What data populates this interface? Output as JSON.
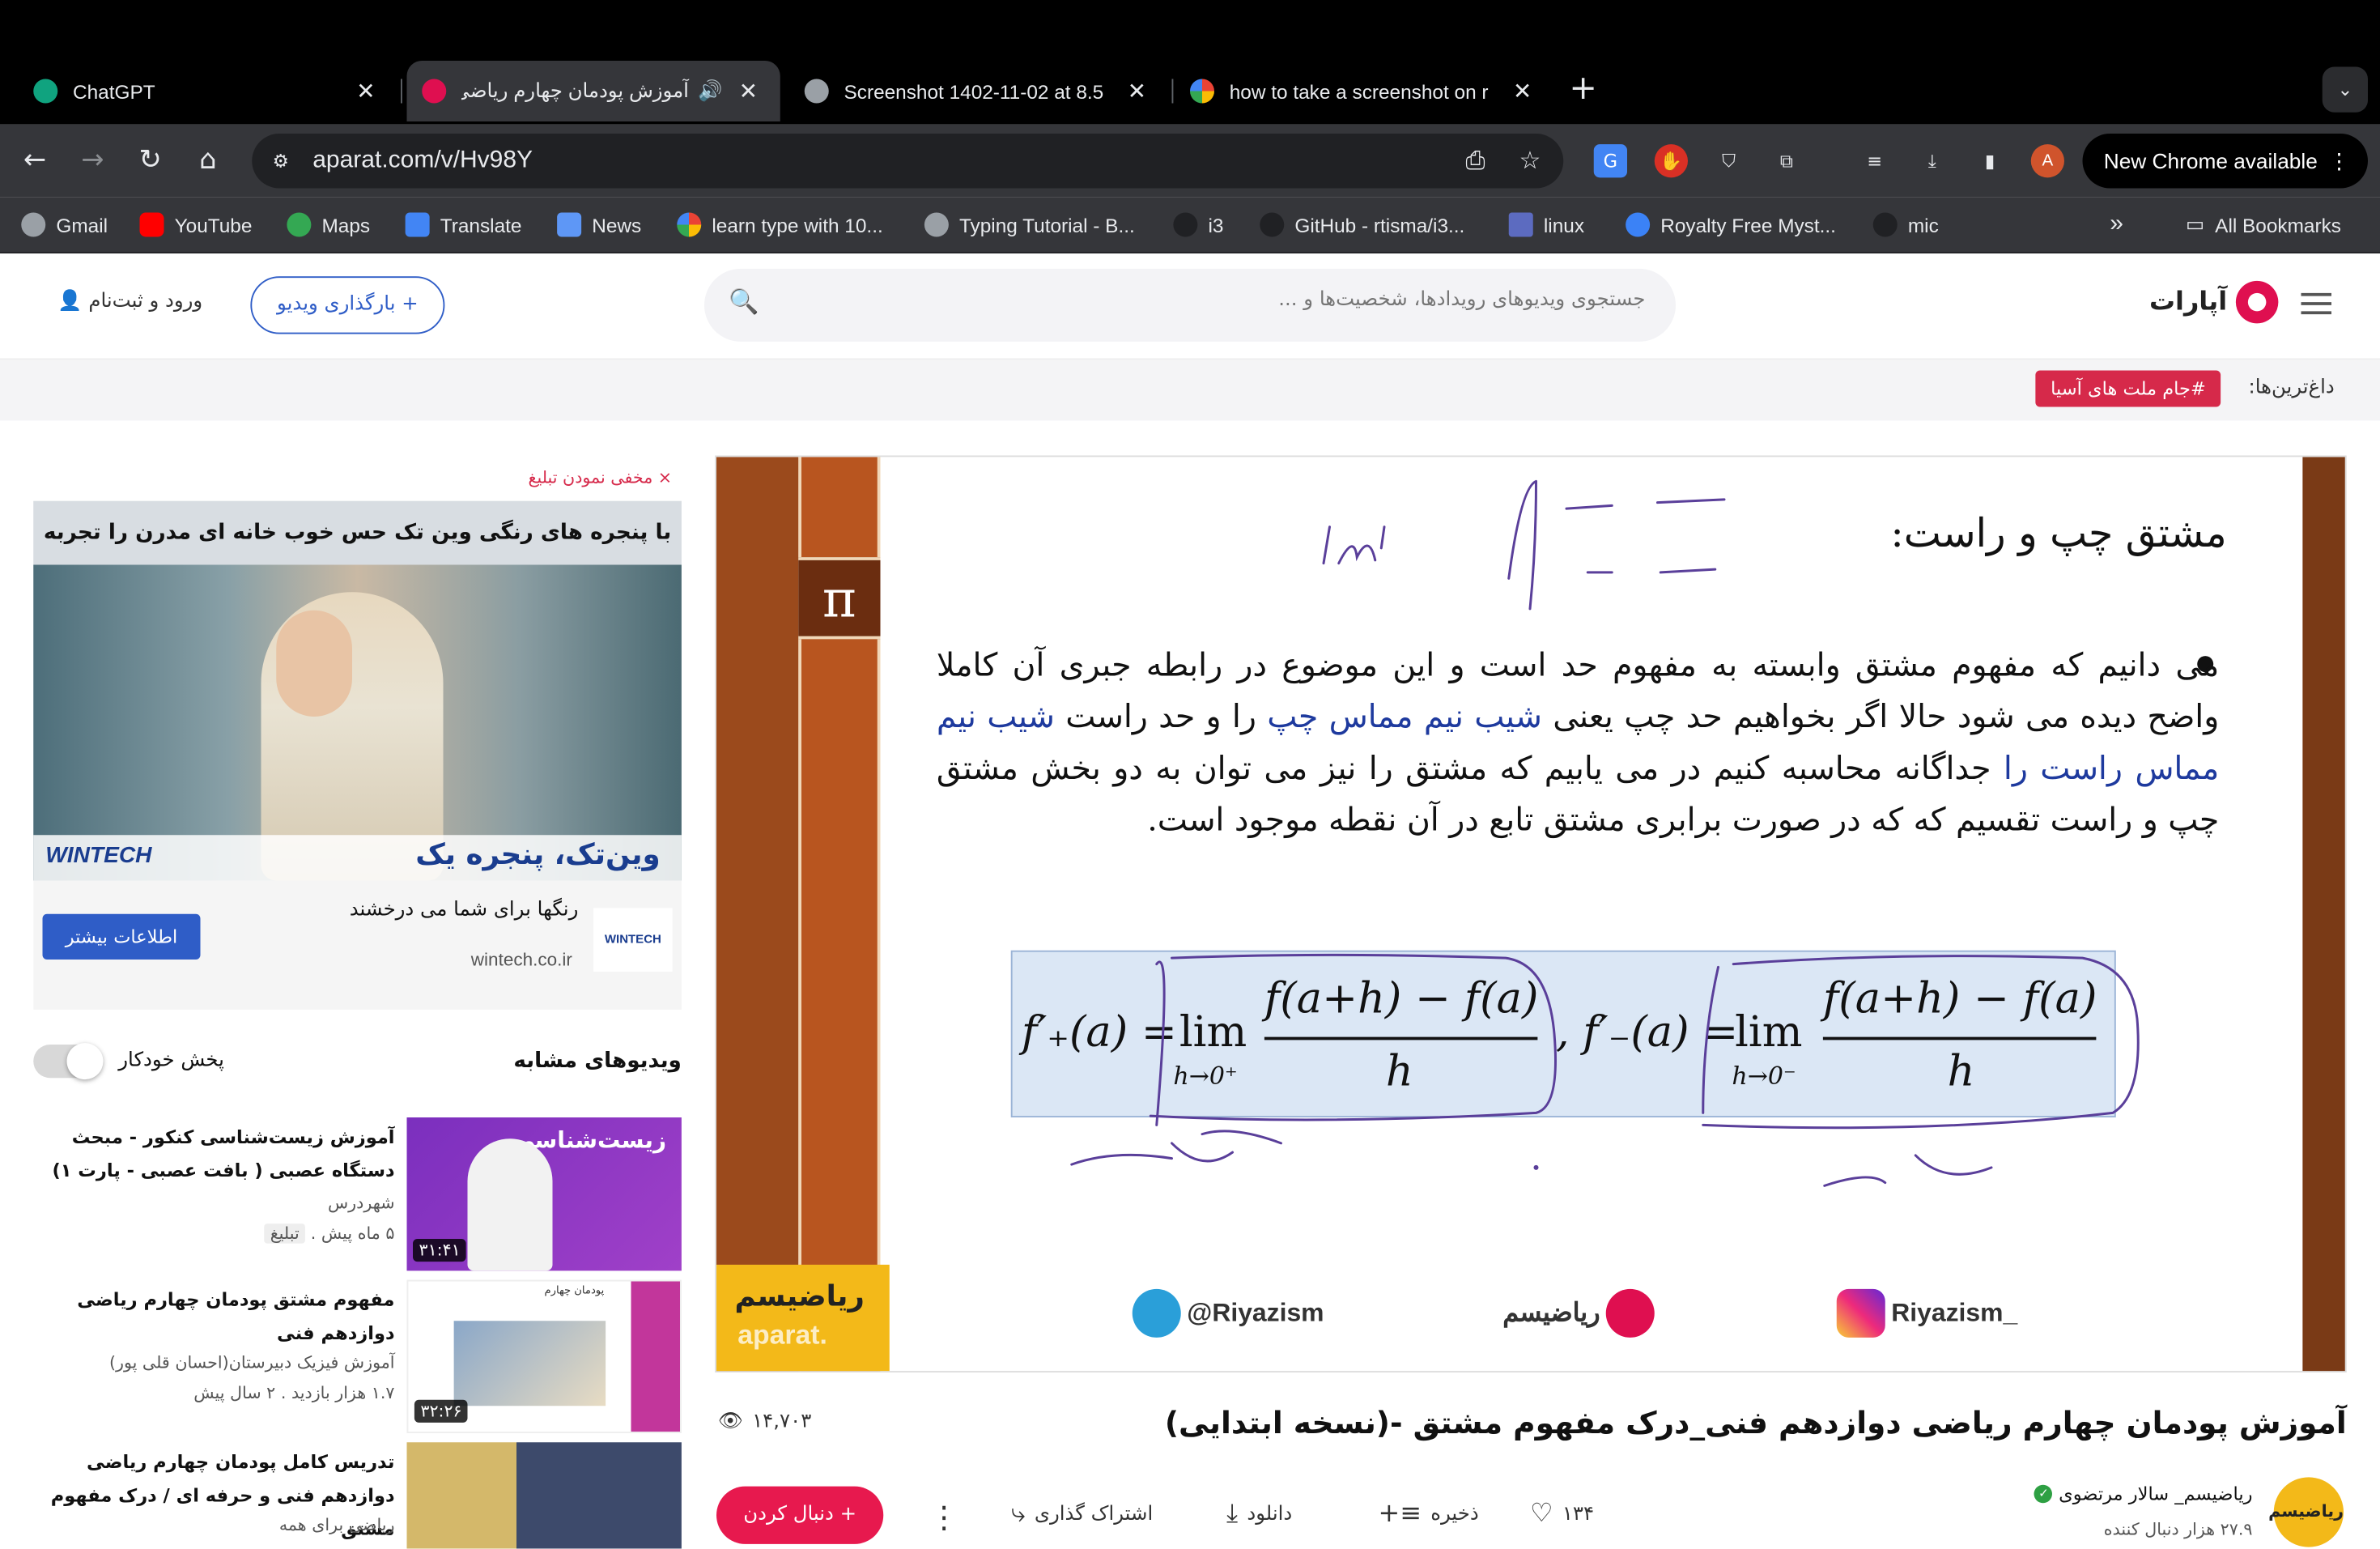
{
  "browser": {
    "tabs": [
      {
        "title": "ChatGPT",
        "color": "#10a37f"
      },
      {
        "title": "آموزش پودمان چهارم ریاضی دو",
        "color": "#df0f50",
        "active": true
      },
      {
        "title": "Screenshot 1402-11-02 at 8.5",
        "color": "#9aa0a6"
      },
      {
        "title": "how to take a screenshot on r",
        "color": "#4285f4"
      }
    ],
    "url": "aparat.com/v/Hv98Y",
    "new_chrome": "New Chrome available",
    "profile_initial": "A",
    "bookmarks": [
      "Gmail",
      "YouTube",
      "Maps",
      "Translate",
      "News",
      "learn type with 10...",
      "Typing Tutorial - B...",
      "i3",
      "GitHub - rtisma/i3...",
      "linux",
      "Royalty Free Myst...",
      "mic"
    ],
    "all_bookmarks": "All Bookmarks"
  },
  "header": {
    "brand": "آپارات",
    "search_placeholder": "جستجوی ویدیوهای رویدادها، شخصیت‌ها و ...",
    "upload": "+ بارگذاری ویدیو",
    "login": "ورود و ثبت‌نام",
    "trending_label": "داغ‌ترین‌ها:",
    "trending_chip": "#جام ملت های آسیا"
  },
  "slide": {
    "title": "مشتق چپ و راست:",
    "paragraph_1": "می دانیم که مفهوم مشتق وابسته به مفهوم حد است و این موضوع در رابطه جبری آن کاملا واضح دیده می شود حالا اگر بخواهیم حد چپ یعنی ",
    "highlight_1": "شیب نیم مماس چپ",
    "paragraph_2": " را و حد راست ",
    "highlight_2": "شیب نیم مماس راست را",
    "paragraph_3": " جداگانه محاسبه کنیم در می یابیم که مشتق را نیز می توان به دو بخش مشتق چپ و راست تقسیم که که در صورت برابری مشتق تابع در آن نقطه موجود است.",
    "formula_right": {
      "fn": "f′₊(a) =",
      "lim": "lim",
      "sub": "h→0⁺",
      "num": "f(a+h) − f(a)",
      "den": "h"
    },
    "formula_left": {
      "fn": ", f′₋(a) =",
      "lim": "lim",
      "sub": "h→0⁻",
      "num": "f(a+h) − f(a)",
      "den": "h"
    },
    "watermark_fa": "ریاضیسم",
    "watermark_en": "aparat.",
    "social_telegram": "@Riyazism",
    "social_aparat": "ریاضیسم",
    "social_instagram": "Riyazism_",
    "pi": "π"
  },
  "video": {
    "title": "آموزش پودمان چهارم ریاضی دوازدهم فنی_درک مفهوم مشتق -(نسخه ابتدایی)",
    "views": "۱۴,۷۰۳",
    "follow": "+ دنبال کردن",
    "share": "اشتراک گذاری",
    "download": "دانلود",
    "save": "ذخیره",
    "likes": "۱۳۴",
    "channel_name": "ریاضیسم_ سالار مرتضوی",
    "channel_subs": "۲۷.۹ هزار دنبال کننده",
    "channel_avatar": "ریاضیسم"
  },
  "sidebar": {
    "hide_ad": "× مخفی نمودن تبلیغ",
    "ad_headline": "با پنجره های رنگی وین تک حس خوب خانه ای مدرن را تجربه کنید",
    "ad_brand": "WINTECH",
    "ad_slogan": "وین‌تک، پنجره یک",
    "ad_text": "رنگها برای شما می درخشند",
    "ad_domain": "wintech.co.ir",
    "ad_button": "اطلاعات بیشتر",
    "similar_label": "ویدیوهای مشابه",
    "autoplay_label": "پخش خودکار",
    "related": [
      {
        "title": "آموزش زیست‌شناسی کنکور - مبحث دستگاه عصبی ( بافت عصبی - پارت ۱)",
        "channel": "شهردرس",
        "meta": "۵ ماه پیش",
        "tag": "تبلیغ",
        "duration": "۳۱:۴۱",
        "thumb_text": "زیست‌شناسی"
      },
      {
        "title": "مفهوم مشتق پودمان چهارم ریاضی دوازدهم فنی",
        "channel": "آموزش فیزیک دبیرستان(احسان قلی پور)",
        "meta": "۱.۷ هزار بازدید . ۲ سال پیش",
        "tag": "",
        "duration": "۳۲:۲۶",
        "thumb_text": "پودمان چهارم"
      },
      {
        "title": "تدریس کامل پودمان چهارم ریاضی دوازدهم فنی و حرفه ای / درک مفهوم مشتق",
        "channel": "ریاضی برای همه",
        "meta": "",
        "tag": "",
        "duration": "",
        "thumb_text": ""
      }
    ]
  }
}
